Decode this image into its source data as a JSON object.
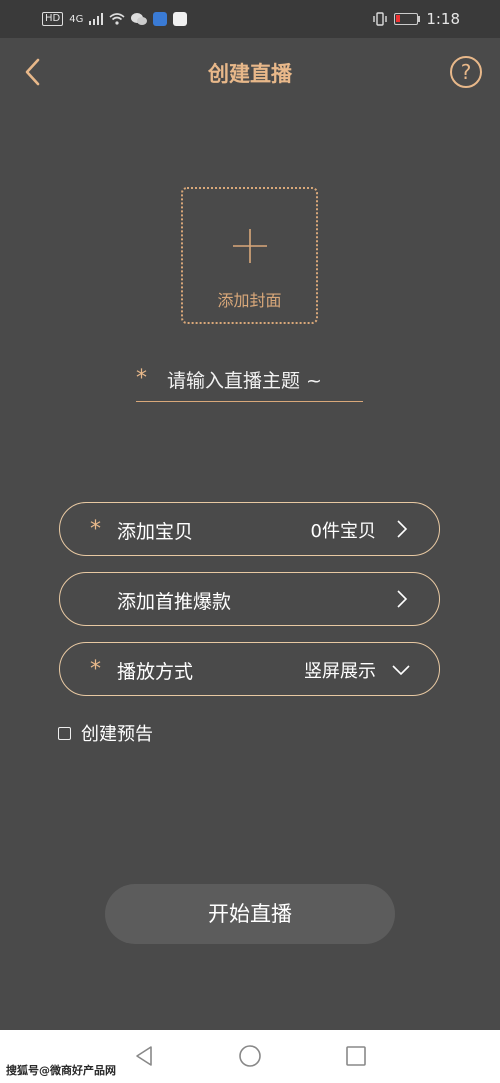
{
  "status_bar": {
    "left_badges": [
      "HD",
      "4G"
    ],
    "time": "1:18"
  },
  "header": {
    "title": "创建直播",
    "help_glyph": "?"
  },
  "cover": {
    "label": "添加封面"
  },
  "topic": {
    "required_mark": "*",
    "placeholder": "请输入直播主题 ~"
  },
  "rows": {
    "add_item": {
      "required_mark": "*",
      "label": "添加宝贝",
      "value": "0件宝贝"
    },
    "featured": {
      "label": "添加首推爆款"
    },
    "play_mode": {
      "required_mark": "*",
      "label": "播放方式",
      "value": "竖屏展示"
    }
  },
  "preview": {
    "label": "创建预告",
    "checked": false
  },
  "start_button": {
    "label": "开始直播"
  },
  "watermark": "搜狐号@微商好产品网",
  "colors": {
    "background": "#4a4a4a",
    "accent": "#e8b88a",
    "button_bg": "#5c5c5c"
  }
}
